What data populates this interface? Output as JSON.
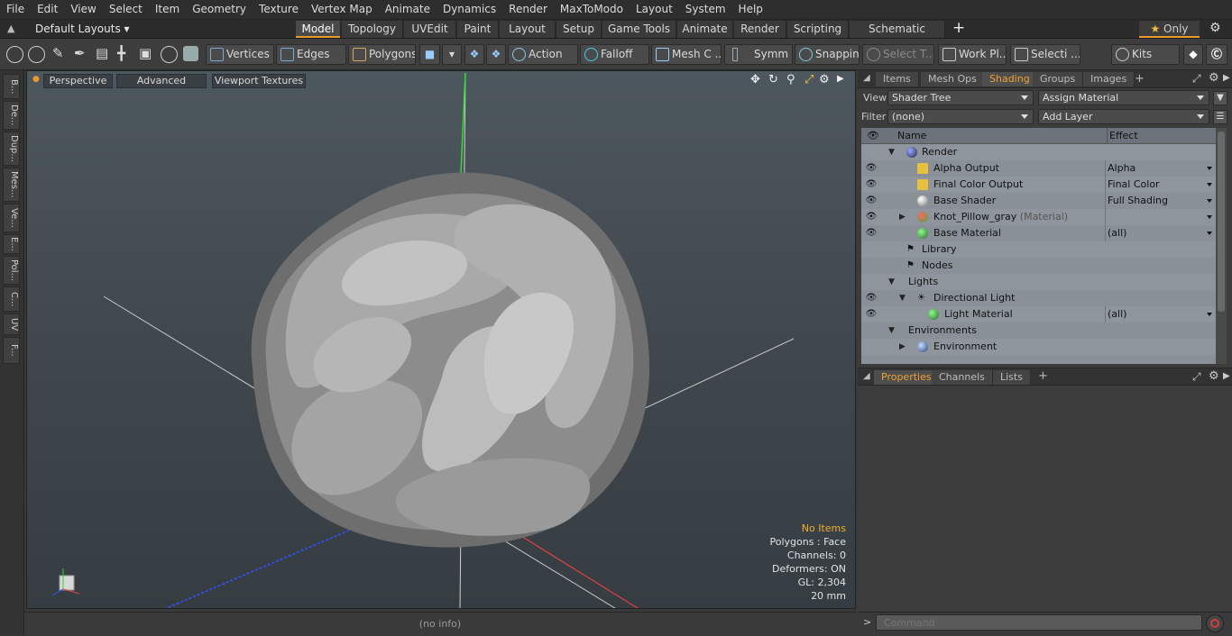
{
  "menu": [
    "File",
    "Edit",
    "View",
    "Select",
    "Item",
    "Geometry",
    "Texture",
    "Vertex Map",
    "Animate",
    "Dynamics",
    "Render",
    "MaxToModo",
    "Layout",
    "System",
    "Help"
  ],
  "layoutbar": {
    "preset": "Default Layouts",
    "tabs": [
      "Model",
      "Topology",
      "UVEdit",
      "Paint",
      "Layout",
      "Setup",
      "Game Tools",
      "Animate",
      "Render",
      "Scripting",
      "Schematic Fusion"
    ],
    "active": "Model",
    "add": "+",
    "only_label": "Only"
  },
  "toolbar": {
    "vertices": "Vertices",
    "edges": "Edges",
    "polygons": "Polygons",
    "action": "Action",
    "falloff": "Falloff",
    "mesh": "Mesh C ...",
    "symm": "Symm ...",
    "snapping": "Snapping",
    "select_t": "Select T...",
    "work_pl": "Work Pl...",
    "selecti": "Selecti ...",
    "kits": "Kits"
  },
  "leftstrip": [
    "B...",
    "De...",
    "Dup...",
    "Mes...",
    "Ve...",
    "E...",
    "Pol...",
    "C...",
    "UV",
    "F..."
  ],
  "viewport": {
    "perspective": "Perspective",
    "advanced": "Advanced",
    "textures": "Viewport Textures",
    "stats": {
      "items": "No Items",
      "polygons": "Polygons : Face",
      "channels": "Channels: 0",
      "deformers": "Deformers: ON",
      "gl": "GL: 2,304",
      "scale": "20 mm"
    }
  },
  "statusbar": "(no info)",
  "panel": {
    "tabs": [
      "Items",
      "Mesh Ops",
      "Shading",
      "Groups",
      "Images"
    ],
    "active": "Shading",
    "add": "+",
    "view_label": "View",
    "view_value": "Shader Tree",
    "assign": "Assign Material",
    "filter_label": "Filter",
    "filter_value": "(none)",
    "add_layer": "Add Layer",
    "col_name": "Name",
    "col_effect": "Effect",
    "rows": [
      {
        "name": "Render",
        "effect": "",
        "eye": false
      },
      {
        "name": "Alpha Output",
        "effect": "Alpha",
        "eye": true
      },
      {
        "name": "Final Color Output",
        "effect": "Final Color",
        "eye": true
      },
      {
        "name": "Base Shader",
        "effect": "Full Shading",
        "eye": true
      },
      {
        "name": "Knot_Pillow_gray",
        "suffix": "(Material)",
        "effect": "",
        "eye": true
      },
      {
        "name": "Base Material",
        "effect": "(all)",
        "eye": true
      },
      {
        "name": "Library",
        "effect": "",
        "eye": false
      },
      {
        "name": "Nodes",
        "effect": "",
        "eye": false
      },
      {
        "name": "Lights",
        "effect": "",
        "eye": false
      },
      {
        "name": "Directional Light",
        "effect": "",
        "eye": true
      },
      {
        "name": "Light Material",
        "effect": "(all)",
        "eye": true
      },
      {
        "name": "Environments",
        "effect": "",
        "eye": false
      },
      {
        "name": "Environment",
        "effect": "",
        "eye": false
      }
    ],
    "bottom_tabs": [
      "Properties",
      "Channels",
      "Lists"
    ],
    "bottom_active": "Properties",
    "bottom_add": "+"
  },
  "command": {
    "placeholder": "Command"
  },
  "colors": {
    "accent": "#e89a2a",
    "tree_bg": "#8a9098"
  }
}
